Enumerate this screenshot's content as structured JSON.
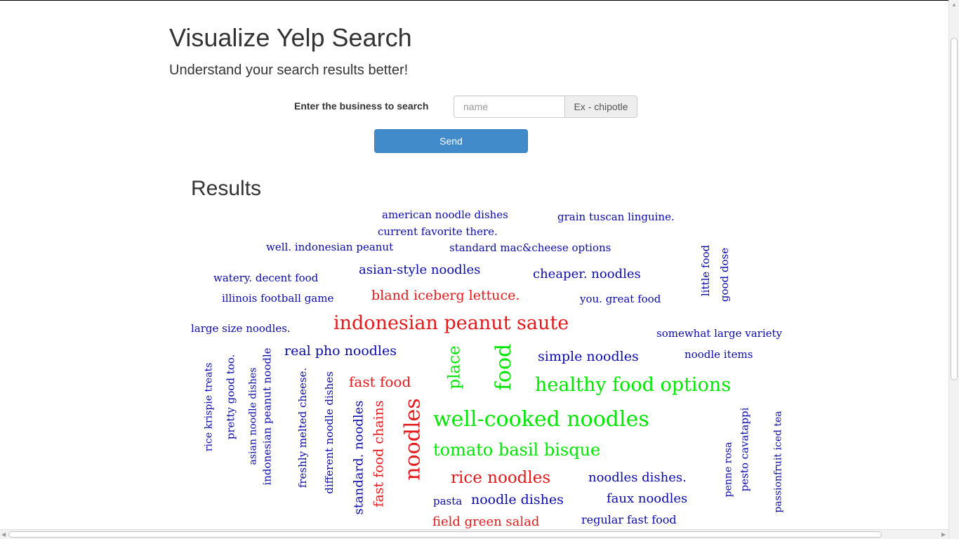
{
  "header": {
    "title": "Visualize Yelp Search",
    "subtitle": "Understand your search results better!"
  },
  "search": {
    "label": "Enter the business to search",
    "placeholder": "name",
    "value": "",
    "addon": "Ex - chipotle",
    "send_label": "Send"
  },
  "results": {
    "heading": "Results"
  },
  "colors": {
    "red": "#e31a1c",
    "green": "#00e600",
    "blue": "#0a0aa8",
    "button": "#428bca"
  },
  "word_cloud": [
    {
      "text": "american noodle dishes",
      "color": "blue"
    },
    {
      "text": "grain tuscan linguine.",
      "color": "blue"
    },
    {
      "text": "current favorite there.",
      "color": "blue"
    },
    {
      "text": "well. indonesian peanut",
      "color": "blue"
    },
    {
      "text": "standard mac&cheese options",
      "color": "blue"
    },
    {
      "text": "asian-style noodles",
      "color": "blue"
    },
    {
      "text": "cheaper. noodles",
      "color": "blue"
    },
    {
      "text": "watery. decent food",
      "color": "blue"
    },
    {
      "text": "bland iceberg lettuce.",
      "color": "red"
    },
    {
      "text": "illinois football game",
      "color": "blue"
    },
    {
      "text": "you. great food",
      "color": "blue"
    },
    {
      "text": "little food",
      "color": "blue"
    },
    {
      "text": "good dose",
      "color": "blue"
    },
    {
      "text": "large size noodles.",
      "color": "blue"
    },
    {
      "text": "indonesian peanut saute",
      "color": "red"
    },
    {
      "text": "somewhat large variety",
      "color": "blue"
    },
    {
      "text": "real pho noodles",
      "color": "blue"
    },
    {
      "text": "simple noodles",
      "color": "blue"
    },
    {
      "text": "noodle items",
      "color": "blue"
    },
    {
      "text": "place",
      "color": "green"
    },
    {
      "text": "food",
      "color": "green"
    },
    {
      "text": "fast food",
      "color": "red"
    },
    {
      "text": "healthy food options",
      "color": "green"
    },
    {
      "text": "rice krispie treats",
      "color": "blue"
    },
    {
      "text": "pretty good too.",
      "color": "blue"
    },
    {
      "text": "asian noodle dishes",
      "color": "blue"
    },
    {
      "text": "indonesian peanut noodle",
      "color": "blue"
    },
    {
      "text": "freshly melted cheese.",
      "color": "blue"
    },
    {
      "text": "different noodle dishes",
      "color": "blue"
    },
    {
      "text": "standard. noodles",
      "color": "blue"
    },
    {
      "text": "fast food chains",
      "color": "red"
    },
    {
      "text": "noodles",
      "color": "red"
    },
    {
      "text": "well-cooked noodles",
      "color": "green"
    },
    {
      "text": "tomato basil bisque",
      "color": "green"
    },
    {
      "text": "rice noodles",
      "color": "red"
    },
    {
      "text": "noodles dishes.",
      "color": "blue"
    },
    {
      "text": "pasta",
      "color": "blue"
    },
    {
      "text": "noodle dishes",
      "color": "blue"
    },
    {
      "text": "faux noodles",
      "color": "blue"
    },
    {
      "text": "field green salad",
      "color": "red"
    },
    {
      "text": "regular fast food",
      "color": "blue"
    },
    {
      "text": "penne rosa",
      "color": "blue"
    },
    {
      "text": "pesto cavatappi",
      "color": "blue"
    },
    {
      "text": "passionfruit iced tea",
      "color": "blue"
    }
  ]
}
